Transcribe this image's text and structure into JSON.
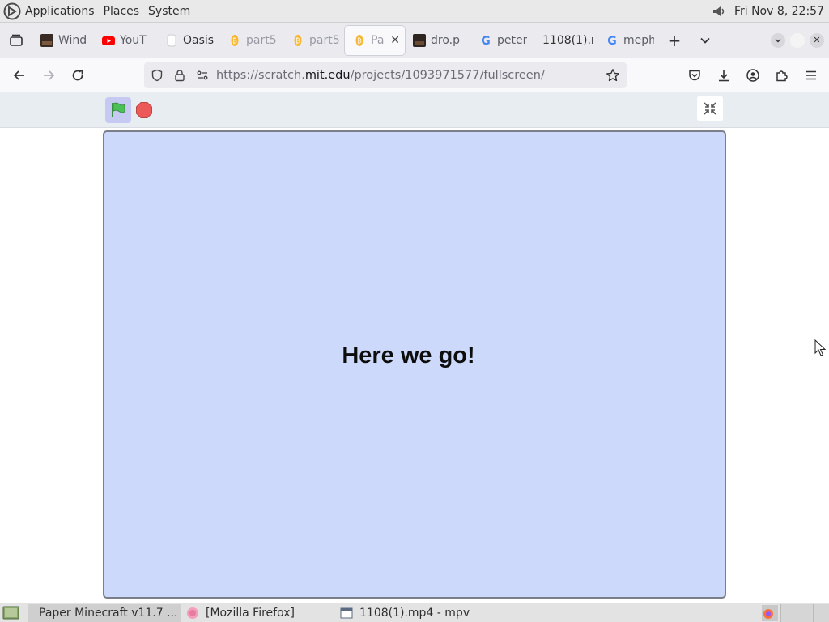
{
  "top_panel": {
    "menus": [
      "Applications",
      "Places",
      "System"
    ],
    "clock": "Fri Nov  8, 22:57"
  },
  "tabs": [
    {
      "label": "Wind",
      "favicon": "dark-thumbnail-icon"
    },
    {
      "label": "YouT",
      "favicon": "youtube-icon"
    },
    {
      "label": "Oasis",
      "favicon": "blank-page-icon"
    },
    {
      "label": "part5",
      "favicon": "bitcoin-icon"
    },
    {
      "label": "part5",
      "favicon": "bitcoin-icon"
    },
    {
      "label": "Pap",
      "favicon": "bitcoin-icon",
      "active": true
    },
    {
      "label": "dro.p",
      "favicon": "dark-thumbnail-icon"
    },
    {
      "label": "peter",
      "favicon": "google-icon"
    },
    {
      "label": "1108(1).r",
      "favicon": "none"
    },
    {
      "label": "meph",
      "favicon": "google-icon"
    }
  ],
  "urlbar": {
    "url_prefix": "https://scratch.",
    "url_domain": "mit.edu",
    "url_suffix": "/projects/1093971577/fullscreen/"
  },
  "stage": {
    "text": "Here we go!",
    "background": "#cdd9fb"
  },
  "taskbar": {
    "tasks": [
      {
        "label": "Paper Minecraft v11.7 ...",
        "active": true
      },
      {
        "label": "[Mozilla Firefox]",
        "active": false
      },
      {
        "label": "1108(1).mp4 - mpv",
        "active": false
      }
    ]
  },
  "colors": {
    "accent_flag": "#4cbf56",
    "stop": "#ec5959",
    "flag_bg": "#c6c9f2"
  }
}
